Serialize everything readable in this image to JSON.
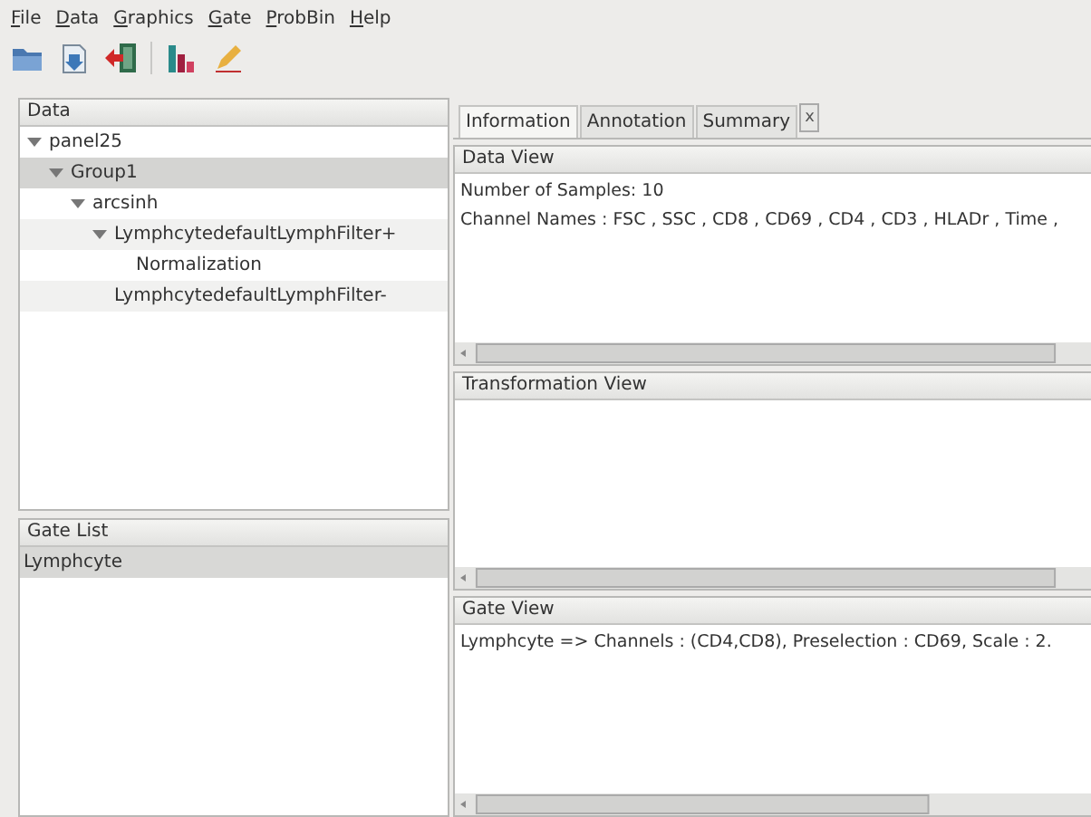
{
  "menu": [
    "File",
    "Data",
    "Graphics",
    "Gate",
    "ProbBin",
    "Help"
  ],
  "toolbar": [
    {
      "kind": "folder"
    },
    {
      "kind": "document"
    },
    {
      "kind": "exit"
    },
    {
      "kind": "separator"
    },
    {
      "kind": "chart"
    },
    {
      "kind": "pencil"
    }
  ],
  "data_panel": {
    "title": "Data",
    "tree": [
      {
        "label": "panel25",
        "expanded": true,
        "selected": false,
        "children": [
          {
            "label": "Group1",
            "expanded": true,
            "selected": true,
            "children": [
              {
                "label": "arcsinh",
                "expanded": true,
                "selected": false,
                "children": [
                  {
                    "label": "LymphcytedefaultLymphFilter+",
                    "expanded": true,
                    "selected": false,
                    "children": [
                      {
                        "label": "Normalization",
                        "selected": false
                      }
                    ]
                  },
                  {
                    "label": "LymphcytedefaultLymphFilter-",
                    "selected": false
                  }
                ]
              }
            ]
          }
        ]
      }
    ]
  },
  "gate_list": {
    "title": "Gate List",
    "items": [
      {
        "label": "Lymphcyte",
        "selected": true
      }
    ]
  },
  "tabs": [
    {
      "label": "Information",
      "selected": true
    },
    {
      "label": "Annotation",
      "selected": false
    },
    {
      "label": "Summary",
      "selected": false
    }
  ],
  "tab_close": "x",
  "views": [
    {
      "title": "Data View",
      "lines": [
        "Number of Samples: 10",
        "Channel Names : FSC , SSC , CD8 , CD69 , CD4 , CD3 , HLADr , Time ,"
      ]
    },
    {
      "title": "Transformation View"
    },
    {
      "title": "Gate View",
      "lines": [
        "Lymphcyte => Channels : (CD4,CD8), Preselection : CD69, Scale : 2."
      ]
    }
  ]
}
